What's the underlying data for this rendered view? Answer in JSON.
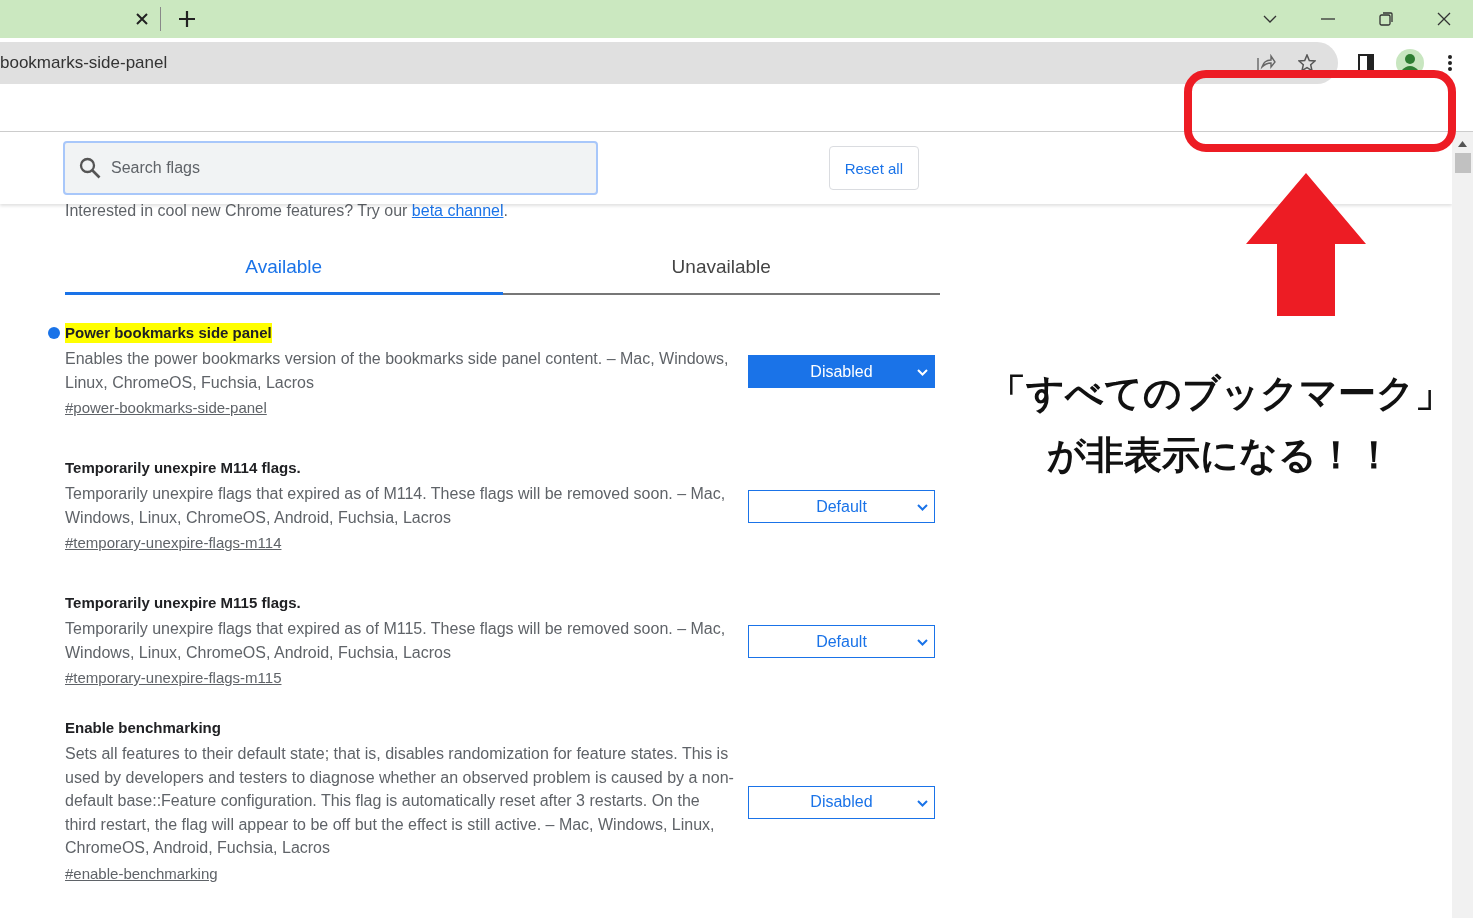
{
  "browser": {
    "address": "bookmarks-side-panel"
  },
  "header": {
    "search": {
      "placeholder": "Search flags"
    },
    "reset_button": "Reset all"
  },
  "intro": {
    "text": "Interested in cool new Chrome features? Try our ",
    "link": "beta channel",
    "after": "."
  },
  "tabs": [
    {
      "label": "Available",
      "selected": true
    },
    {
      "label": "Unavailable",
      "selected": false
    }
  ],
  "flags": [
    {
      "title": "Power bookmarks side panel",
      "modified": true,
      "description": "Enables the power bookmarks version of the bookmarks side panel content. – Mac, Windows, Linux, ChromeOS, Fuchsia, Lacros",
      "link": "#power-bookmarks-side-panel",
      "value": "Disabled"
    },
    {
      "title": "Temporarily unexpire M114 flags.",
      "modified": false,
      "description": "Temporarily unexpire flags that expired as of M114. These flags will be removed soon. – Mac, Windows, Linux, ChromeOS, Android, Fuchsia, Lacros",
      "link": "#temporary-unexpire-flags-m114",
      "value": "Default"
    },
    {
      "title": "Temporarily unexpire M115 flags.",
      "modified": false,
      "description": "Temporarily unexpire flags that expired as of M115. These flags will be removed soon. – Mac, Windows, Linux, ChromeOS, Android, Fuchsia, Lacros",
      "link": "#temporary-unexpire-flags-m115",
      "value": "Default"
    },
    {
      "title": "Enable benchmarking",
      "modified": false,
      "description": "Sets all features to their default state; that is, disables randomization for feature states. This is used by developers and testers to diagnose whether an observed problem is caused by a non-default base::Feature configuration. This flag is automatically reset after 3 restarts. On the third restart, the flag will appear to be off but the effect is still active. – Mac, Windows, Linux, ChromeOS, Android, Fuchsia, Lacros",
      "link": "#enable-benchmarking",
      "value": "Disabled"
    }
  ],
  "annotation": {
    "lines": [
      "「すべてのブックマーク」",
      "が非表示になる！！"
    ]
  }
}
